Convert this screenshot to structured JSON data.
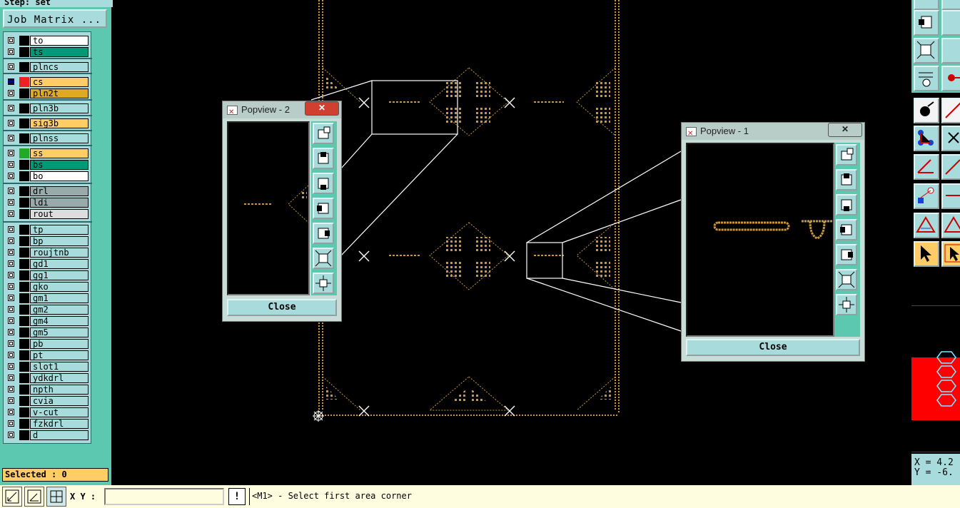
{
  "step": {
    "label": "Step: set"
  },
  "job_matrix": {
    "label": "Job Matrix ..."
  },
  "layers": [
    {
      "name": "to",
      "swatch": "#000000",
      "bg": "#ffffff",
      "check": "#ffffff"
    },
    {
      "name": "ts",
      "swatch": "#000000",
      "bg": "#009977",
      "check": "#ffffff"
    },
    {
      "name": "plncs",
      "swatch": "#000000",
      "bg": "#a8dcdc",
      "check": "#ffffff"
    },
    {
      "name": "cs",
      "swatch": "#ee2222",
      "bg": "#ffcc66",
      "check": "#0000aa"
    },
    {
      "name": "pln2t",
      "swatch": "#000000",
      "bg": "#ddaa22",
      "check": "#ffffff"
    },
    {
      "name": "pln3b",
      "swatch": "#000000",
      "bg": "#a8dcdc",
      "check": "#ffffff"
    },
    {
      "name": "sig3b",
      "swatch": "#000000",
      "bg": "#ffcc66",
      "check": "#ffffff"
    },
    {
      "name": "plnss",
      "swatch": "#000000",
      "bg": "#a8dcdc",
      "check": "#ffffff"
    },
    {
      "name": "ss",
      "swatch": "#22aa22",
      "bg": "#ffcc66",
      "check": "#ffffff"
    },
    {
      "name": "bs",
      "swatch": "#000000",
      "bg": "#009977",
      "check": "#ffffff"
    },
    {
      "name": "bo",
      "swatch": "#000000",
      "bg": "#ffffff",
      "check": "#ffffff"
    },
    {
      "name": "drl",
      "swatch": "#000000",
      "bg": "#99aaaa",
      "check": "#ffffff"
    },
    {
      "name": "ldi",
      "swatch": "#000000",
      "bg": "#99aaaa",
      "check": "#ffffff"
    },
    {
      "name": "rout",
      "swatch": "#000000",
      "bg": "#dddddd",
      "check": "#ffffff"
    },
    {
      "name": "tp",
      "swatch": "#000000",
      "bg": "#a8dcdc",
      "check": "#ffffff"
    },
    {
      "name": "bp",
      "swatch": "#000000",
      "bg": "#a8dcdc",
      "check": "#ffffff"
    },
    {
      "name": "roujtnb",
      "swatch": "#000000",
      "bg": "#a8dcdc",
      "check": "#ffffff"
    },
    {
      "name": "gd1",
      "swatch": "#000000",
      "bg": "#a8dcdc",
      "check": "#ffffff"
    },
    {
      "name": "gg1",
      "swatch": "#000000",
      "bg": "#a8dcdc",
      "check": "#ffffff"
    },
    {
      "name": "gko",
      "swatch": "#000000",
      "bg": "#a8dcdc",
      "check": "#ffffff"
    },
    {
      "name": "gm1",
      "swatch": "#000000",
      "bg": "#a8dcdc",
      "check": "#ffffff"
    },
    {
      "name": "gm2",
      "swatch": "#000000",
      "bg": "#a8dcdc",
      "check": "#ffffff"
    },
    {
      "name": "gm4",
      "swatch": "#000000",
      "bg": "#a8dcdc",
      "check": "#ffffff"
    },
    {
      "name": "gm5",
      "swatch": "#000000",
      "bg": "#a8dcdc",
      "check": "#ffffff"
    },
    {
      "name": "pb",
      "swatch": "#000000",
      "bg": "#a8dcdc",
      "check": "#ffffff"
    },
    {
      "name": "pt",
      "swatch": "#000000",
      "bg": "#a8dcdc",
      "check": "#ffffff"
    },
    {
      "name": "slot1",
      "swatch": "#000000",
      "bg": "#a8dcdc",
      "check": "#ffffff"
    },
    {
      "name": "ydkdrl",
      "swatch": "#000000",
      "bg": "#a8dcdc",
      "check": "#ffffff"
    },
    {
      "name": "npth",
      "swatch": "#000000",
      "bg": "#a8dcdc",
      "check": "#ffffff"
    },
    {
      "name": "cvia",
      "swatch": "#000000",
      "bg": "#a8dcdc",
      "check": "#ffffff"
    },
    {
      "name": "v-cut",
      "swatch": "#000000",
      "bg": "#a8dcdc",
      "check": "#ffffff"
    },
    {
      "name": "fzkdrl",
      "swatch": "#000000",
      "bg": "#a8dcdc",
      "check": "#ffffff"
    },
    {
      "name": "d",
      "swatch": "#000000",
      "bg": "#a8dcdc",
      "check": "#ffffff"
    }
  ],
  "selected": {
    "label": "Selected : 0"
  },
  "bottom": {
    "xy_label": "X Y :",
    "xy_value": "",
    "warn": "!",
    "message": "<M1> - Select first area corner"
  },
  "coords": {
    "x": "X = 4.2",
    "y": "Y = -6."
  },
  "popview2": {
    "title": "Popview - 2",
    "close_label": "Close",
    "x_label": "✕"
  },
  "popview1": {
    "title": "Popview - 1",
    "close_label": "Close",
    "x_label": "✕"
  },
  "colors": {
    "accent": "#5cc8b0",
    "panel": "#a8dcdc",
    "copper": "#c8963c",
    "status": "#ffcc66"
  }
}
